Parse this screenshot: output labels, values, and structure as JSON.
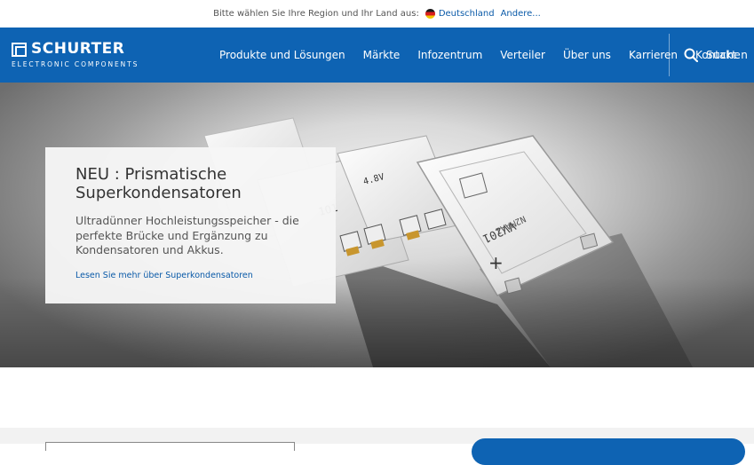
{
  "region_bar": {
    "prompt": "Bitte wählen Sie Ihre Region und Ihr Land aus:",
    "country": "Deutschland",
    "other": "Andere..."
  },
  "header": {
    "logo_name": "SCHURTER",
    "logo_sub": "ELECTRONIC COMPONENTS",
    "menu": [
      {
        "label": "Produkte und Lösungen"
      },
      {
        "label": "Märkte"
      },
      {
        "label": "Infozentrum"
      },
      {
        "label": "Verteiler"
      },
      {
        "label": "Über uns"
      },
      {
        "label": "Karrieren"
      },
      {
        "label": "Kontakt"
      }
    ],
    "search_label": "Suchen"
  },
  "hero": {
    "title": "NEU : Prismatische Superkondensatoren",
    "text": "Ultradünner Hochleistungsspeicher - die perfekte Brücke und Ergänzung zu Kondensatoren und Akkus.",
    "link": "Lesen Sie mehr über Superkondensatoren"
  },
  "colors": {
    "brand_blue": "#0e63b3",
    "link_blue": "#0a5aa8"
  }
}
